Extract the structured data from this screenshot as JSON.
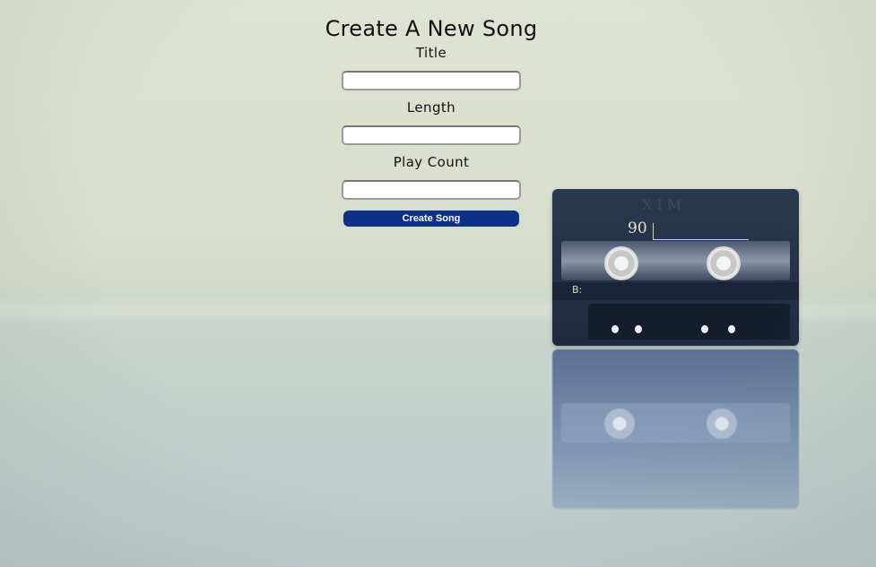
{
  "form": {
    "heading": "Create A New Song",
    "fields": [
      {
        "label": "Title",
        "value": ""
      },
      {
        "label": "Length",
        "value": ""
      },
      {
        "label": "Play Count",
        "value": ""
      }
    ],
    "submit_label": "Create Song"
  },
  "colors": {
    "button_bg": "#0d3285",
    "cassette": "#1d2a3f"
  },
  "cassette_text": {
    "number": "90",
    "side": "B:"
  }
}
